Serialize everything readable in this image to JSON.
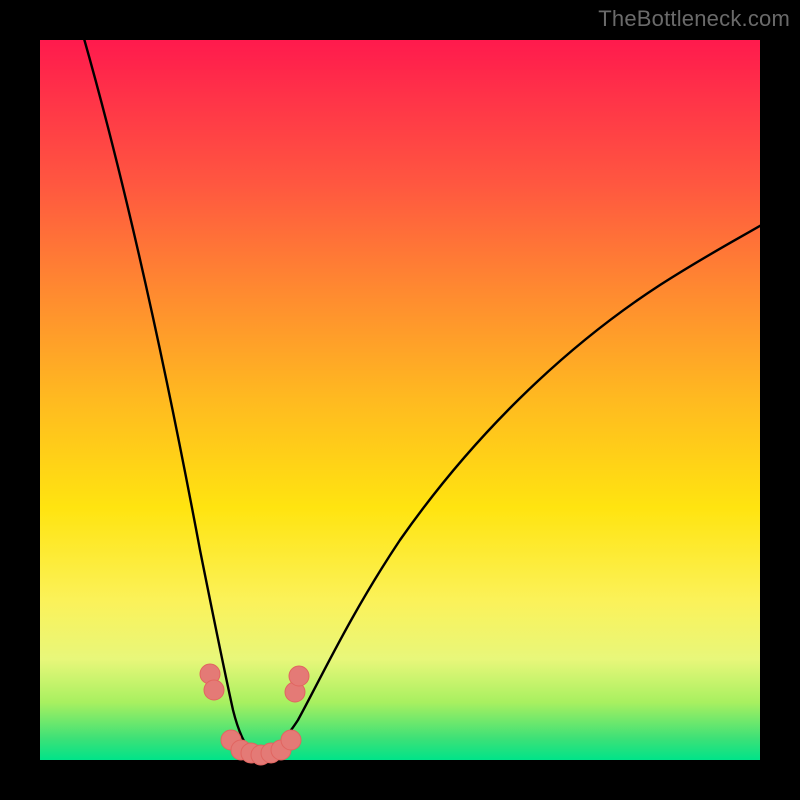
{
  "watermark": "TheBottleneck.com",
  "chart_data": {
    "type": "line",
    "title": "",
    "xlabel": "",
    "ylabel": "",
    "xlim": [
      0,
      100
    ],
    "ylim": [
      0,
      100
    ],
    "grid": false,
    "legend": false,
    "series": [
      {
        "name": "left-curve",
        "x": [
          6,
          10,
          15,
          20,
          22,
          24,
          26,
          27,
          28,
          29,
          30
        ],
        "y": [
          100,
          80,
          55,
          30,
          20,
          12,
          6,
          3,
          1,
          0,
          0
        ]
      },
      {
        "name": "right-curve",
        "x": [
          30,
          32,
          34,
          36,
          40,
          45,
          50,
          60,
          70,
          80,
          90,
          100
        ],
        "y": [
          0,
          0,
          2,
          5,
          12,
          20,
          28,
          42,
          53,
          62,
          70,
          76
        ]
      }
    ],
    "markers": [
      {
        "x": 23.5,
        "y": 12
      },
      {
        "x": 24.0,
        "y": 10
      },
      {
        "x": 26.5,
        "y": 2.5
      },
      {
        "x": 28.0,
        "y": 1.2
      },
      {
        "x": 29.0,
        "y": 0.8
      },
      {
        "x": 30.0,
        "y": 0.5
      },
      {
        "x": 31.5,
        "y": 0.7
      },
      {
        "x": 33.0,
        "y": 1.2
      },
      {
        "x": 34.5,
        "y": 2.5
      },
      {
        "x": 35.0,
        "y": 9
      },
      {
        "x": 35.5,
        "y": 11
      }
    ],
    "marker_color": "#e47a76",
    "line_color": "#000000",
    "background_gradient": [
      "#ff1a4d",
      "#ffba20",
      "#fbf25a",
      "#00e389"
    ]
  }
}
